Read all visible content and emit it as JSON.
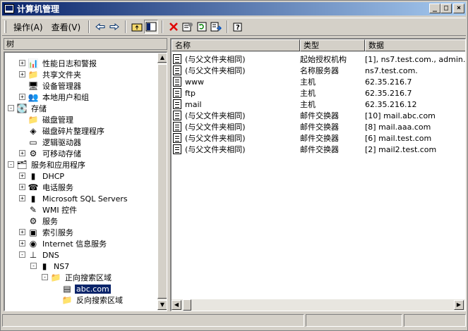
{
  "window": {
    "title": "计算机管理"
  },
  "title_buttons": [
    "_",
    "□",
    "×"
  ],
  "menu": {
    "action": "操作(A)",
    "view": "查看(V)"
  },
  "toolbar": {
    "icons": [
      "back-arrow-icon",
      "forward-arrow-icon",
      "up-folder-icon",
      "show-tree-icon",
      "delete-icon",
      "properties-icon",
      "refresh-icon",
      "export-icon",
      "help-icon"
    ]
  },
  "tree": {
    "header": "树",
    "items": [
      {
        "label": "性能日志和警报",
        "icon": "performance-logs-icon"
      },
      {
        "label": "共享文件夹",
        "icon": "shared-folder-icon"
      },
      {
        "label": "设备管理器",
        "icon": "device-manager-icon"
      },
      {
        "label": "本地用户和组",
        "icon": "users-groups-icon"
      },
      {
        "label": "存储",
        "icon": "storage-icon"
      },
      {
        "label": "磁盘管理",
        "icon": "disk-management-icon"
      },
      {
        "label": "磁盘碎片整理程序",
        "icon": "defrag-icon"
      },
      {
        "label": "逻辑驱动器",
        "icon": "logical-drive-icon"
      },
      {
        "label": "可移动存储",
        "icon": "removable-storage-icon"
      },
      {
        "label": "服务和应用程序",
        "icon": "services-apps-icon"
      },
      {
        "label": "DHCP",
        "icon": "dhcp-icon"
      },
      {
        "label": "电话服务",
        "icon": "telephony-icon"
      },
      {
        "label": "Microsoft SQL Servers",
        "icon": "sql-server-icon"
      },
      {
        "label": "WMI 控件",
        "icon": "wmi-icon"
      },
      {
        "label": "服务",
        "icon": "services-icon"
      },
      {
        "label": "索引服务",
        "icon": "indexing-icon"
      },
      {
        "label": "Internet 信息服务",
        "icon": "iis-icon"
      },
      {
        "label": "DNS",
        "icon": "dns-icon"
      },
      {
        "label": "NS7",
        "icon": "server-icon"
      },
      {
        "label": "正向搜索区域",
        "icon": "folder-icon"
      },
      {
        "label": "abc.com",
        "icon": "zone-icon"
      },
      {
        "label": "反向搜索区域",
        "icon": "folder-icon"
      }
    ]
  },
  "list": {
    "columns": [
      "名称",
      "类型",
      "数据"
    ],
    "rows": [
      {
        "name": "(与父文件夹相同)",
        "type": "起始授权机构",
        "data": "[1], ns7.test.com., admin."
      },
      {
        "name": "(与父文件夹相同)",
        "type": "名称服务器",
        "data": "ns7.test.com."
      },
      {
        "name": "www",
        "type": "主机",
        "data": "62.35.216.7"
      },
      {
        "name": "ftp",
        "type": "主机",
        "data": "62.35.216.7"
      },
      {
        "name": "mail",
        "type": "主机",
        "data": "62.35.216.12"
      },
      {
        "name": "(与父文件夹相同)",
        "type": "邮件交换器",
        "data": "[10]  mail.abc.com"
      },
      {
        "name": "(与父文件夹相同)",
        "type": "邮件交换器",
        "data": "[8]  mail.aaa.com"
      },
      {
        "name": "(与父文件夹相同)",
        "type": "邮件交换器",
        "data": "[6]  mail.test.com"
      },
      {
        "name": "(与父文件夹相同)",
        "type": "邮件交换器",
        "data": "[2]  mail2.test.com"
      }
    ]
  },
  "colors": {
    "titlebar_start": "#0a246a",
    "titlebar_end": "#a6caf0",
    "selection": "#0a246a",
    "face": "#d4d0c8"
  }
}
